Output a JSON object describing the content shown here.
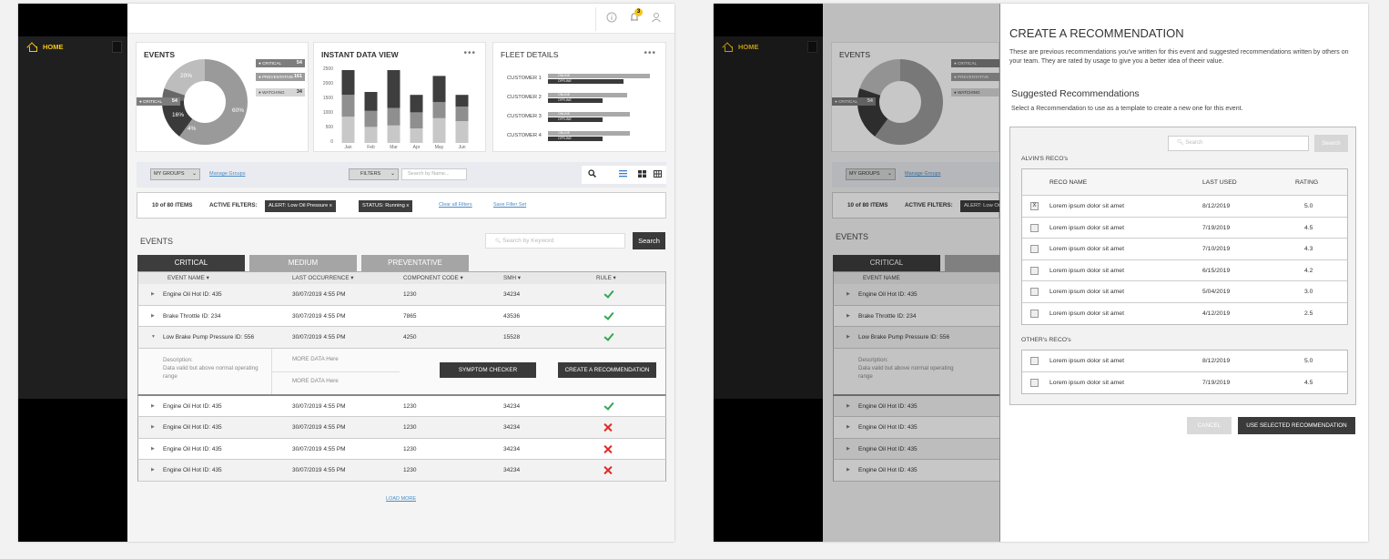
{
  "sidebar": {
    "home_label": "HOME"
  },
  "topbar": {
    "info_icon": "info-icon",
    "bell_badge": "3"
  },
  "events_card": {
    "title": "EVENTS",
    "legend": [
      {
        "label": "CRITICAL",
        "value": "54"
      },
      {
        "label": "PREVENTATIVE",
        "value": "161"
      },
      {
        "label": "WATCHING",
        "value": "34"
      }
    ],
    "callout": {
      "label": "CRITICAL",
      "value": "54"
    },
    "pie_labels": [
      "20%",
      "60%",
      "16%",
      "4%"
    ]
  },
  "instant_card": {
    "title": "INSTANT DATA VIEW",
    "y_ticks": [
      "2500",
      "2000",
      "1500",
      "1000",
      "500",
      "0"
    ],
    "months": [
      "Jan",
      "Feb",
      "Mar",
      "Apr",
      "May",
      "Jun"
    ]
  },
  "chart_data": {
    "type": "bar",
    "categories": [
      "Jan",
      "Feb",
      "Mar",
      "Apr",
      "May",
      "Jun"
    ],
    "ylim": [
      0,
      2500
    ],
    "series": [
      {
        "values": [
          900,
          550,
          600,
          500,
          850,
          750
        ]
      },
      {
        "values": [
          750,
          550,
          600,
          550,
          550,
          500
        ]
      },
      {
        "values": [
          950,
          650,
          1450,
          600,
          900,
          400
        ]
      }
    ]
  },
  "fleet_card": {
    "title": "FLEET DETAILS",
    "customers": [
      "CUSTOMER 1",
      "CUSTOMER 2",
      "CUSTOMER 3",
      "CUSTOMER 4"
    ],
    "online_label": "ONLINE",
    "offline_label": "OFFLINE"
  },
  "filterbar": {
    "groups": "MY GROUPS",
    "manage": "Manage Groups",
    "filters": "FILTERS",
    "search_placeholder": "Search by Name..."
  },
  "activebar": {
    "count": "10 of 80 ITEMS",
    "active_label": "ACTIVE FILTERS:",
    "chips": [
      "ALERT: Low Oil Pressure  x",
      "STATUS: Running  x"
    ],
    "clear": "Clear all Filters",
    "save": "Save Filter Set"
  },
  "events_section": {
    "title": "EVENTS",
    "keyword_placeholder": "Search by Keyword",
    "search_label": "Search",
    "tabs": [
      "CRITICAL",
      "MEDIUM",
      "PREVENTATIVE"
    ],
    "columns": [
      "EVENT NAME",
      "LAST OCCURRENCE",
      "COMPONENT CODE",
      "SMH",
      "RULE"
    ],
    "rows": [
      {
        "name": "Engine Oil Hot ID: 435",
        "date": "30/07/2019 4:55 PM",
        "code": "1230",
        "smh": "34234"
      },
      {
        "name": "Brake Throttle ID: 234",
        "date": "30/07/2019 4:55 PM",
        "code": "7865",
        "smh": "43536"
      },
      {
        "name": "Low Brake Pump Pressure ID: 556",
        "date": "30/07/2019 4:55 PM",
        "code": "4250",
        "smh": "15528"
      }
    ],
    "expanded": {
      "desc_label": "Description:",
      "desc_text": "Data valid but above normal operating range",
      "more1": "MORE DATA Here",
      "more2": "MORE DATA Here",
      "symptom": "SYMPTOM CHECKER",
      "create": "CREATE A RECOMMENDATION"
    },
    "rows2": [
      {
        "name": "Engine Oil Hot ID: 435",
        "date": "30/07/2019 4:55 PM",
        "code": "1230",
        "smh": "34234"
      },
      {
        "name": "Engine Oil Hot ID: 435",
        "date": "30/07/2019 4:55 PM",
        "code": "1230",
        "smh": "34234"
      },
      {
        "name": "Engine Oil Hot ID: 435",
        "date": "30/07/2019 4:55 PM",
        "code": "1230",
        "smh": "34234"
      },
      {
        "name": "Engine Oil Hot ID: 435",
        "date": "30/07/2019 4:55 PM",
        "code": "1230",
        "smh": "34234"
      }
    ],
    "load_more": "LOAD MORE"
  },
  "modal": {
    "title": "CREATE A RECOMMENDATION",
    "desc": "These are previous recommendations you've written for this event and suggested recommendations written by others on your team. They are rated by usage to give you a better idea of theeir value.",
    "sub_title": "Suggested Recommendations",
    "sub_desc": "Select a Recommendation to use as a template to create a new one for this event.",
    "search_placeholder": "Search",
    "search_btn": "Search",
    "alvin_label": "ALVIN'S RECO's",
    "columns": [
      "RECO NAME",
      "LAST USED",
      "RATING"
    ],
    "alvin_rows": [
      {
        "name": "Lorem ipsum dolor sit amet",
        "date": "8/12/2019",
        "rating": "5.0",
        "checked": "X"
      },
      {
        "name": "Lorem ipsum dolor sit amet",
        "date": "7/19/2019",
        "rating": "4.5",
        "checked": ""
      },
      {
        "name": "Lorem ipsum dolor sit amet",
        "date": "7/10/2019",
        "rating": "4.3",
        "checked": ""
      },
      {
        "name": "Lorem ipsum dolor sit amet",
        "date": "6/15/2019",
        "rating": "4.2",
        "checked": ""
      },
      {
        "name": "Lorem ipsum dolor sit amet",
        "date": "5/04/2019",
        "rating": "3.0",
        "checked": ""
      },
      {
        "name": "Lorem ipsum dolor sit amet",
        "date": "4/12/2019",
        "rating": "2.5",
        "checked": ""
      }
    ],
    "other_label": "OTHER's RECO's",
    "other_rows": [
      {
        "name": "Lorem ipsum dolor sit amet",
        "date": "8/12/2019",
        "rating": "5.0",
        "checked": ""
      },
      {
        "name": "Lorem ipsum dolor sit amet",
        "date": "7/19/2019",
        "rating": "4.5",
        "checked": ""
      }
    ],
    "cancel": "CANCEL",
    "use": "USE SELECTED RECOMMENDATION"
  }
}
